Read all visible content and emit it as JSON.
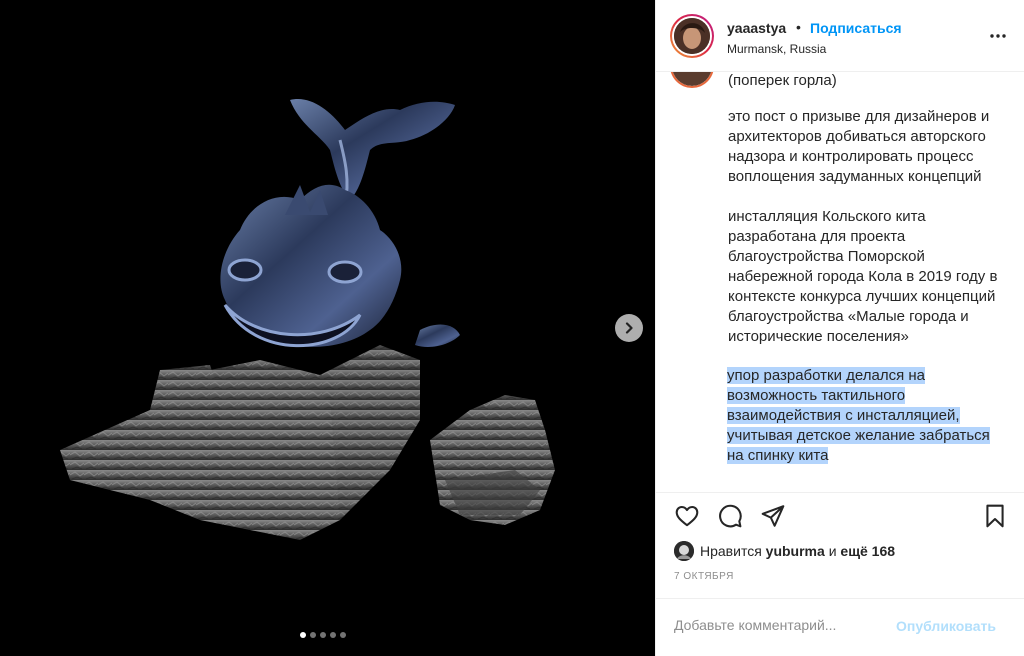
{
  "header": {
    "username": "yaaastya",
    "bullet": "•",
    "follow_label": "Подписаться",
    "location": "Murmansk, Russia",
    "more_icon": "more-horizontal-icon"
  },
  "caption": {
    "paragraphs": [
      "(поперек горла)",
      "это пост о призыве для дизайнеров и архитекторов добиваться авторского надзора и контролировать процесс воплощения задуманных концепций",
      "инсталляция Кольского кита разработана для проекта благоустройства Поморской набережной города Кола в 2019 году в контексте конкурса лучших концепций благоустройства «Малые города и исторические поселения»",
      "упор разработки делался на возможность тактильного взаимодействия с инсталляцией, учитывая детское желание забраться на спинку кита"
    ]
  },
  "actions": {
    "like_icon": "heart-icon",
    "comment_icon": "comment-icon",
    "share_icon": "paper-plane-icon",
    "save_icon": "bookmark-icon"
  },
  "likes": {
    "prefix": "Нравится",
    "user": "yuburma",
    "conjunction": "и",
    "more": "ещё 168"
  },
  "date": "7 октября",
  "comment": {
    "placeholder": "Добавьте комментарий...",
    "post_label": "Опубликовать"
  },
  "carousel": {
    "total": 5,
    "active_index": 0
  },
  "colors": {
    "accent": "#0095f6",
    "post_disabled": "#b2dffc",
    "selection": "#b3d4fc",
    "muted": "#8e8e8e"
  }
}
